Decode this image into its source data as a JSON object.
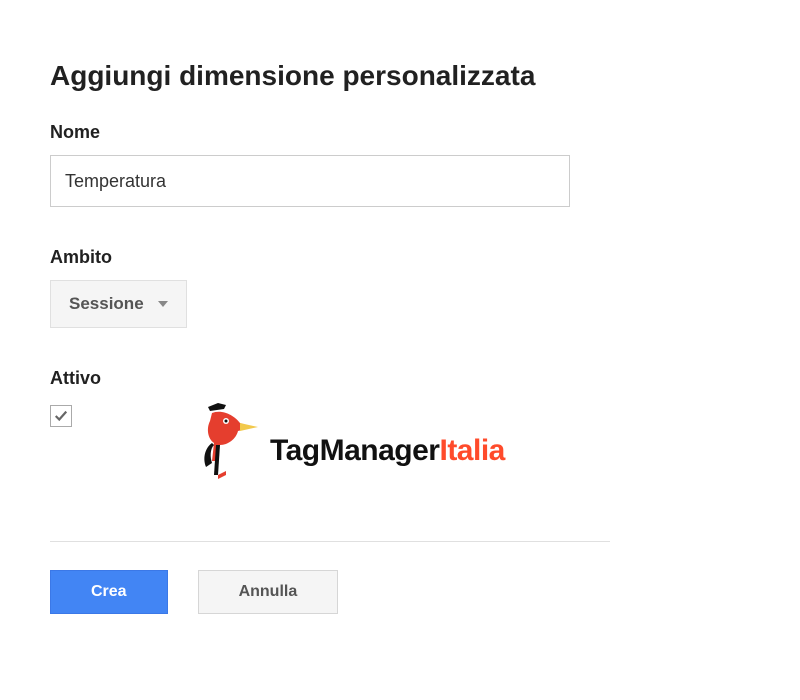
{
  "title": "Aggiungi dimensione personalizzata",
  "fields": {
    "name": {
      "label": "Nome",
      "value": "Temperatura"
    },
    "scope": {
      "label": "Ambito",
      "selected": "Sessione"
    },
    "active": {
      "label": "Attivo",
      "checked": true
    }
  },
  "logo": {
    "text_main": "TagManager",
    "text_accent": "Italia"
  },
  "buttons": {
    "create": "Crea",
    "cancel": "Annulla"
  }
}
